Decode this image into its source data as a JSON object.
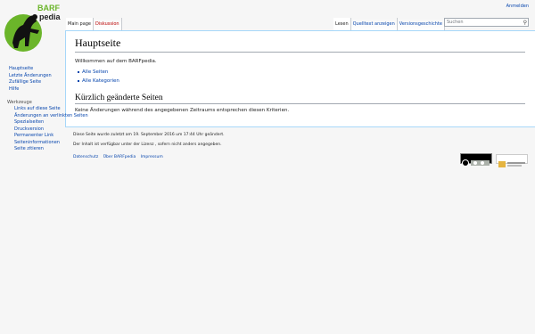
{
  "logo": {
    "text_barf": "BARF",
    "text_pedia": "pedia"
  },
  "personal": {
    "login": "Anmelden"
  },
  "tabs_left": [
    {
      "label": "Main page",
      "selected": true,
      "new": false
    },
    {
      "label": "Diskussion",
      "selected": false,
      "new": true
    }
  ],
  "tabs_right": [
    {
      "label": "Lesen",
      "selected": true
    },
    {
      "label": "Quelltext anzeigen",
      "selected": false
    },
    {
      "label": "Versionsgeschichte",
      "selected": false
    }
  ],
  "search": {
    "placeholder": "Suchen"
  },
  "main": {
    "title": "Hauptseite",
    "intro": "Willkommen auf dem BARFpedia.",
    "links": [
      "Alle Seiten",
      "Alle Kategorien"
    ],
    "recent_heading": "Kürzlich geänderte Seiten",
    "recent_text": "Keine Änderungen während des angegebenen Zeitraums entsprechen diesen Kriterien."
  },
  "sidebar": {
    "nav": [
      "Hauptseite",
      "Letzte Änderungen",
      "Zufällige Seite",
      "Hilfe"
    ],
    "tools_heading": "Werkzeuge",
    "tools": [
      "Links auf diese Seite",
      "Änderungen an verlinkten Seiten",
      "Spezialseiten",
      "Druckversion",
      "Permanenter Link",
      "Seiteninformationen",
      "Seite zitieren"
    ]
  },
  "footer": {
    "lastmod": "Diese Seite wurde zuletzt am 19. September 2016 um 17:44 Uhr geändert.",
    "license": "Der Inhalt ist verfügbar unter der Lizenz , sofern nicht anders angegeben.",
    "links": [
      "Datenschutz",
      "Über BARFpedia",
      "Impressum"
    ]
  },
  "colors": {
    "link": "#0645ad",
    "new_link": "#ba0000",
    "logo_green": "#6bb52a"
  },
  "icons": {
    "search": "magnifier-icon",
    "license": "cc-by-sa-icon",
    "powered": "mediawiki-icon"
  }
}
